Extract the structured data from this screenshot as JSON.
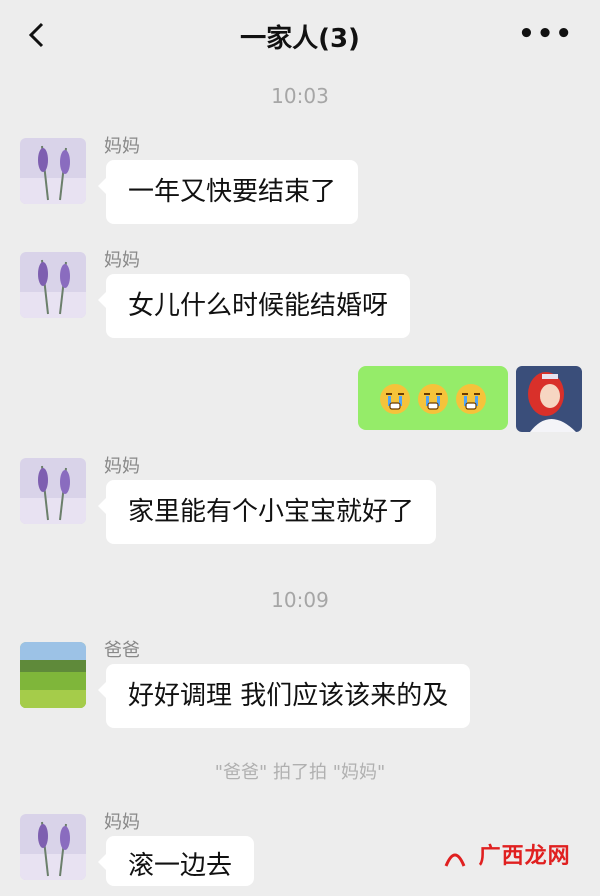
{
  "header": {
    "title": "一家人(3)",
    "back_icon": "chevron-left-icon",
    "more_icon": "more-dots-icon",
    "more_label": "•••"
  },
  "messages": {
    "time1": "10:03",
    "m1": {
      "sender": "妈妈",
      "text": "一年又快要结束了"
    },
    "m2": {
      "sender": "妈妈",
      "text": "女儿什么时候能结婚呀"
    },
    "m3": {
      "emoji": "crying-face-emoji x3"
    },
    "m4": {
      "sender": "妈妈",
      "text": "家里能有个小宝宝就好了"
    },
    "time2": "10:09",
    "m5": {
      "sender": "爸爸",
      "text": "好好调理 我们应该该来的及"
    },
    "system": "\"爸爸\" 拍了拍 \"妈妈\"",
    "m6": {
      "sender": "妈妈",
      "text": "滚一边去"
    }
  },
  "watermark": "广西龙网",
  "colors": {
    "background": "#ededed",
    "bubble_in": "#ffffff",
    "bubble_out": "#95ec69"
  }
}
